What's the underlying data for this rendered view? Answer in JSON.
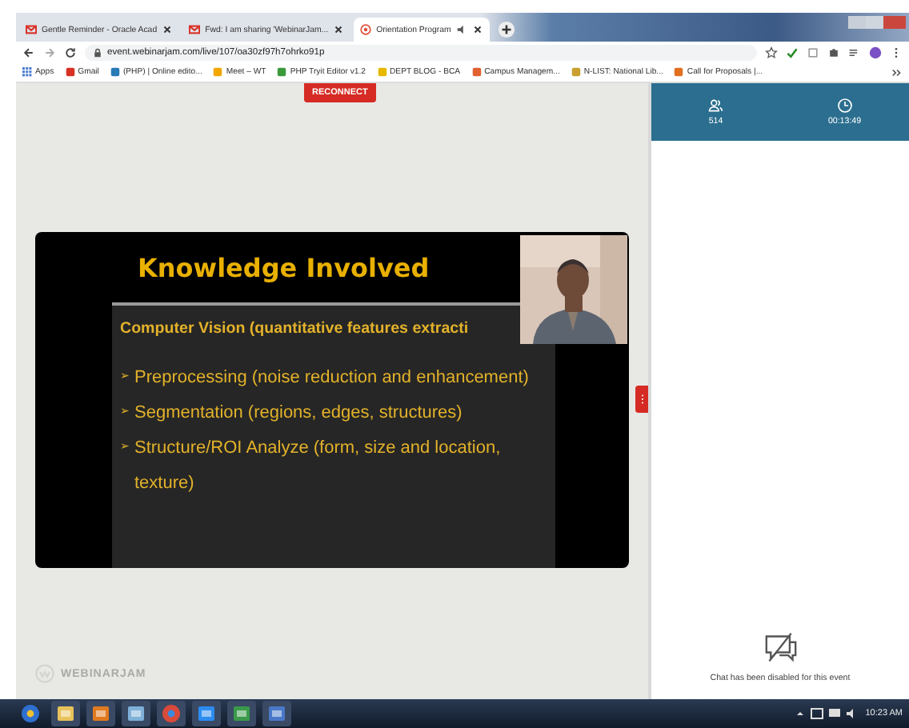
{
  "browser": {
    "tabs": [
      {
        "kind": "mail",
        "title": "Gentle Reminder - Oracle Acad",
        "selected": false
      },
      {
        "kind": "mail",
        "title": "Fwd: I am sharing 'WebinarJam...",
        "selected": false
      },
      {
        "kind": "webinar",
        "title": "Orientation Program",
        "selected": true
      }
    ],
    "url": "event.webinarjam.com/live/107/oa30zf97h7ohrko91p",
    "bookmarks": [
      {
        "kind": "apps",
        "label": "Apps"
      },
      {
        "kind": "mail",
        "label": "Gmail"
      },
      {
        "kind": "globe",
        "label": "(PHP) | Online edito..."
      },
      {
        "kind": "meet",
        "label": "Meet – WT"
      },
      {
        "kind": "editor",
        "label": "PHP Tryit Editor v1.2"
      },
      {
        "kind": "blog",
        "label": "DEPT BLOG - BCA"
      },
      {
        "kind": "campus",
        "label": "Campus Managem..."
      },
      {
        "kind": "library",
        "label": "N-LIST: National Lib..."
      },
      {
        "kind": "flag",
        "label": "Call for Proposals |..."
      }
    ]
  },
  "stage": {
    "reconnect_button": "RECONNECT",
    "slide": {
      "title": "Knowledge Involved",
      "subtitle": "Computer Vision (quantitative features extracti",
      "bullets": [
        {
          "marker": "➢",
          "text": "Preprocessing (noise reduction and enhancement)"
        },
        {
          "marker": "➢",
          "text": "Segmentation (regions, edges, structures)"
        },
        {
          "marker": "➢",
          "text": "Structure/ROI Analyze (form, size and location, texture)"
        }
      ]
    },
    "logo": "WEBINARJAM"
  },
  "sidebar": {
    "stats": [
      {
        "kind": "attendees",
        "value": "514"
      },
      {
        "kind": "timer",
        "value": "00:13:49"
      }
    ],
    "chat_notice": "Chat has been disabled for this event"
  },
  "taskbar": {
    "apps": [
      {
        "kind": "start"
      },
      {
        "kind": "folder"
      },
      {
        "kind": "media"
      },
      {
        "kind": "notes"
      },
      {
        "kind": "chrome"
      },
      {
        "kind": "camera"
      },
      {
        "kind": "sheet"
      },
      {
        "kind": "doc"
      }
    ],
    "clock": "10:23 AM"
  }
}
